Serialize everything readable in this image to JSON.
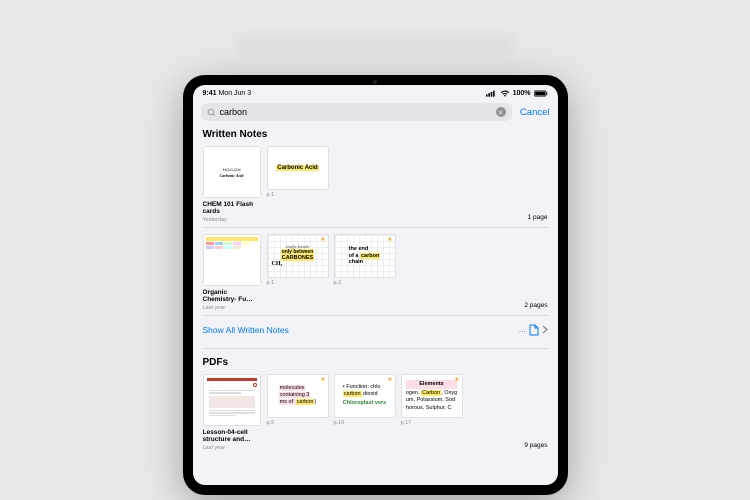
{
  "status": {
    "time": "9:41",
    "date": "Mon Jun 3",
    "battery_pct": "100%"
  },
  "search": {
    "value": "carbon",
    "cancel": "Cancel"
  },
  "sections": {
    "written_notes_title": "Written Notes",
    "pdfs_title": "PDFs",
    "show_all_written": "Show All Written Notes",
    "show_all_dots": "..."
  },
  "results": {
    "written": [
      {
        "title": "CHEM 101 Flash cards",
        "meta": "Yesterday",
        "main_thumb_text": "Carbonic Acid",
        "matches": [
          {
            "page": "p.1",
            "text": "Carbonic Acid"
          }
        ],
        "page_count": "1 page"
      },
      {
        "title": "Organic Chemistry- Fu…",
        "meta": "Last year",
        "matches": [
          {
            "page": "p.1",
            "line1": "single bonds",
            "line2": "only between",
            "hl": "CARBONES",
            "sub": "CH₃"
          },
          {
            "page": "p.2",
            "line1": "the end",
            "line2a": "of a ",
            "hl": "carbon",
            "line3": "chain"
          }
        ],
        "page_count": "2 pages"
      }
    ],
    "pdfs": [
      {
        "title": "Lesson-04-cell structure and…",
        "meta": "Last year",
        "matches": [
          {
            "page": "p.9",
            "t1": "molecules",
            "t2": "containing 3",
            "t3a": "ms of ",
            "hl": "carbon",
            "t3b": ")"
          },
          {
            "page": "p.10",
            "bullet": "•  Function: chlo",
            "hl": "carbon",
            "t2": " dioxid",
            "green": "Chloroplast vers"
          },
          {
            "page": "p.17",
            "title": "Elements",
            "l1a": "ogen, ",
            "hl": "Carbon",
            "l1b": ", Oxyg",
            "l2": "um, Potassium, Sod",
            "l3": "horous, Sulphur, C"
          }
        ],
        "page_count": "9 pages"
      }
    ]
  }
}
